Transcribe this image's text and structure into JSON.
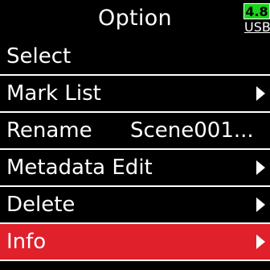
{
  "header": {
    "title": "Option",
    "battery_level": "4.8",
    "power_source": "USB",
    "battery_color": "#1bd31b"
  },
  "menu": {
    "items": [
      {
        "label": "Select",
        "value": "",
        "has_submenu": false,
        "icon": ""
      },
      {
        "label": "Mark List",
        "value": "",
        "has_submenu": true,
        "icon": "chevron-right-icon"
      },
      {
        "label": "Rename",
        "value": "Scene001...",
        "has_submenu": false,
        "icon": ""
      },
      {
        "label": "Metadata Edit",
        "value": "",
        "has_submenu": true,
        "icon": "chevron-right-icon"
      },
      {
        "label": "Delete",
        "value": "",
        "has_submenu": true,
        "icon": "chevron-right-icon"
      },
      {
        "label": "Info",
        "value": "",
        "has_submenu": true,
        "icon": "chevron-right-icon",
        "selected": true
      }
    ],
    "selected_color": "#e0202b"
  }
}
